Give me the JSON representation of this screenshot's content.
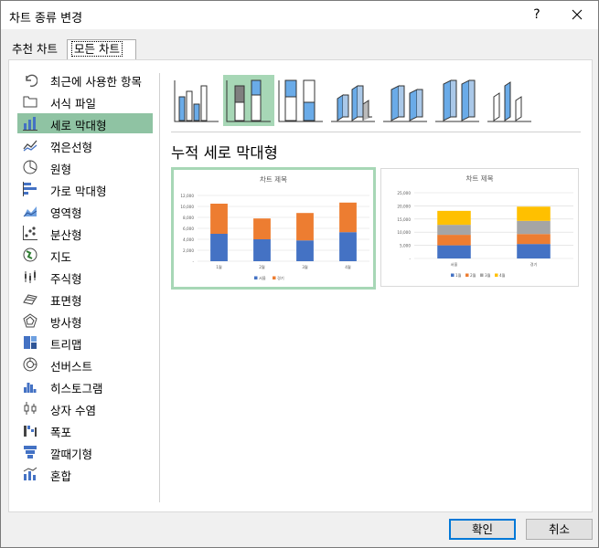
{
  "dialog": {
    "title": "차트 종류 변경",
    "help_label": "?"
  },
  "tabs": [
    "추천 차트",
    "모든 차트"
  ],
  "sidebar": {
    "items": [
      {
        "label": "최근에 사용한 항목",
        "icon": "undo-icon"
      },
      {
        "label": "서식 파일",
        "icon": "folder-icon"
      },
      {
        "label": "세로 막대형",
        "icon": "column-chart-icon"
      },
      {
        "label": "꺾은선형",
        "icon": "line-chart-icon"
      },
      {
        "label": "원형",
        "icon": "pie-chart-icon"
      },
      {
        "label": "가로 막대형",
        "icon": "bar-chart-icon"
      },
      {
        "label": "영역형",
        "icon": "area-chart-icon"
      },
      {
        "label": "분산형",
        "icon": "scatter-chart-icon"
      },
      {
        "label": "지도",
        "icon": "map-chart-icon"
      },
      {
        "label": "주식형",
        "icon": "stock-chart-icon"
      },
      {
        "label": "표면형",
        "icon": "surface-chart-icon"
      },
      {
        "label": "방사형",
        "icon": "radar-chart-icon"
      },
      {
        "label": "트리맵",
        "icon": "treemap-chart-icon"
      },
      {
        "label": "선버스트",
        "icon": "sunburst-chart-icon"
      },
      {
        "label": "히스토그램",
        "icon": "histogram-chart-icon"
      },
      {
        "label": "상자 수염",
        "icon": "box-whisker-chart-icon"
      },
      {
        "label": "폭포",
        "icon": "waterfall-chart-icon"
      },
      {
        "label": "깔때기형",
        "icon": "funnel-chart-icon"
      },
      {
        "label": "혼합",
        "icon": "combo-chart-icon"
      }
    ],
    "selected_index": 2
  },
  "subtypes": {
    "selected_index": 1,
    "selected_title": "누적 세로 막대형",
    "icons": [
      "clustered-column-icon",
      "stacked-column-icon",
      "100-stacked-column-icon",
      "3d-clustered-column-icon",
      "3d-stacked-column-icon",
      "3d-100-stacked-column-icon",
      "3d-column-icon"
    ]
  },
  "colors": {
    "accent_green": "#8fc3a3",
    "series_blue": "#4472c4",
    "series_orange": "#ed7d31",
    "series_gray": "#a5a5a5",
    "series_yellow": "#ffc000"
  },
  "chart_data": [
    {
      "type": "bar",
      "stacked": true,
      "title": "차트 제목",
      "categories": [
        "1월",
        "2월",
        "3월",
        "4월"
      ],
      "series": [
        {
          "name": "서울",
          "values": [
            5000,
            4000,
            3800,
            5300
          ]
        },
        {
          "name": "경기",
          "values": [
            5500,
            3800,
            5000,
            5400
          ]
        }
      ],
      "ylim": [
        0,
        12000
      ],
      "yticks": [
        "-",
        "2,000",
        "4,000",
        "6,000",
        "8,000",
        "10,000",
        "12,000"
      ],
      "legend": "bottom",
      "grid": true
    },
    {
      "type": "bar",
      "stacked": true,
      "title": "차트 제목",
      "categories": [
        "서울",
        "경기"
      ],
      "series": [
        {
          "name": "1월",
          "values": [
            5000,
            5500
          ]
        },
        {
          "name": "2월",
          "values": [
            4000,
            3800
          ]
        },
        {
          "name": "3월",
          "values": [
            3800,
            5000
          ]
        },
        {
          "name": "4월",
          "values": [
            5300,
            5400
          ]
        }
      ],
      "ylim": [
        0,
        25000
      ],
      "yticks": [
        "-",
        "5,000",
        "10,000",
        "15,000",
        "20,000",
        "25,000"
      ],
      "legend": "bottom",
      "grid": true
    }
  ],
  "buttons": {
    "ok": "확인",
    "cancel": "취소"
  }
}
